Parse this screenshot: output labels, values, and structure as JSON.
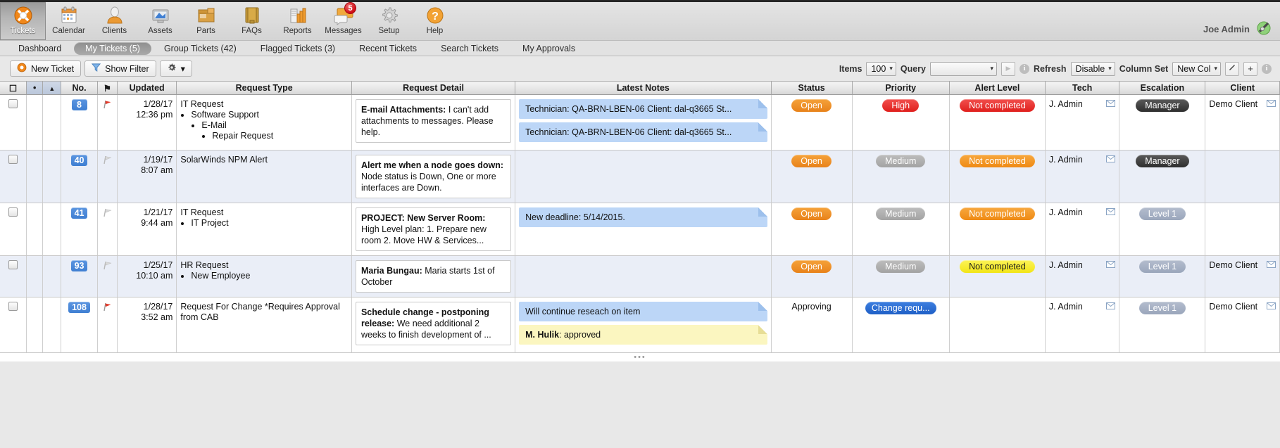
{
  "nav": {
    "items": [
      {
        "label": "Tickets",
        "icon": "lifering-icon",
        "active": true
      },
      {
        "label": "Calendar",
        "icon": "calendar-icon",
        "active": false
      },
      {
        "label": "Clients",
        "icon": "person-icon",
        "active": false
      },
      {
        "label": "Assets",
        "icon": "monitor-icon",
        "active": false
      },
      {
        "label": "Parts",
        "icon": "box-icon",
        "active": false
      },
      {
        "label": "FAQs",
        "icon": "book-icon",
        "active": false
      },
      {
        "label": "Reports",
        "icon": "bar-chart-icon",
        "active": false
      },
      {
        "label": "Messages",
        "icon": "speech-bubble-icon",
        "active": false,
        "badge": "5"
      },
      {
        "label": "Setup",
        "icon": "gear-icon",
        "active": false
      },
      {
        "label": "Help",
        "icon": "question-mark-icon",
        "active": false
      }
    ],
    "user": "Joe Admin"
  },
  "subtabs": [
    {
      "label": "Dashboard",
      "active": false
    },
    {
      "label": "My Tickets (5)",
      "active": true
    },
    {
      "label": "Group Tickets (42)",
      "active": false
    },
    {
      "label": "Flagged Tickets (3)",
      "active": false
    },
    {
      "label": "Recent Tickets",
      "active": false
    },
    {
      "label": "Search Tickets",
      "active": false
    },
    {
      "label": "My Approvals",
      "active": false
    }
  ],
  "toolbar": {
    "new_ticket_label": "New Ticket",
    "show_filter_label": "Show Filter",
    "gear_caret": "▾",
    "items_label": "Items",
    "items_value": "100",
    "query_label": "Query",
    "query_value": "",
    "run_query_glyph": "▶",
    "refresh_label": "Refresh",
    "refresh_value": "Disable",
    "column_set_label": "Column Set",
    "column_set_value": "New Col",
    "edit_glyph": "╱",
    "add_glyph": "+",
    "info_glyph": "i",
    "caret": "▾"
  },
  "table": {
    "headers": {
      "select": "☐",
      "dot": "•",
      "sort": "▲",
      "no": "No.",
      "flag": "⚑",
      "updated": "Updated",
      "request_type": "Request Type",
      "request_detail": "Request Detail",
      "latest_notes": "Latest Notes",
      "status": "Status",
      "priority": "Priority",
      "alert_level": "Alert Level",
      "tech": "Tech",
      "escalation": "Escalation",
      "client": "Client"
    },
    "rows": [
      {
        "no": "8",
        "flagged": true,
        "updated_date": "1/28/17",
        "updated_time": "12:36 pm",
        "type_main": "IT Request",
        "type_sub": "Software Support",
        "type_sub2": "E-Mail",
        "type_sub3": "Repair Request",
        "detail_title": "E-mail Attachments:",
        "detail_text": " I can't add attachments to messages. Please help.",
        "notes": [
          {
            "text": "Technician: QA-BRN-LBEN-06 Client: dal-q3665 St...",
            "color": "blue",
            "truncate": true
          },
          {
            "text": "Technician: QA-BRN-LBEN-06 Client: dal-q3665 St...",
            "color": "blue",
            "truncate": true
          }
        ],
        "status": "Open",
        "status_style": "orange",
        "priority": "High",
        "priority_style": "red",
        "alert": "Not completed",
        "alert_style": "red",
        "tech": "J. Admin",
        "escalation": "Manager",
        "escalation_style": "dark",
        "client": "Demo Client"
      },
      {
        "no": "40",
        "flagged": false,
        "updated_date": "1/19/17",
        "updated_time": "8:07 am",
        "type_main": "SolarWinds NPM Alert",
        "detail_title": "Alert me when a node goes down:",
        "detail_text": " Node status is Down, One or more interfaces are Down.",
        "notes": [],
        "status": "Open",
        "status_style": "orange",
        "priority": "Medium",
        "priority_style": "grey",
        "alert": "Not completed",
        "alert_style": "orange2",
        "tech": "J. Admin",
        "escalation": "Manager",
        "escalation_style": "dark",
        "client": ""
      },
      {
        "no": "41",
        "flagged": false,
        "updated_date": "1/21/17",
        "updated_time": "9:44 am",
        "type_main": "IT Request",
        "type_sub": "IT Project",
        "detail_title": "PROJECT: New Server Room:",
        "detail_text": " High Level plan: 1. Prepare new room 2. Move HW & Services...",
        "notes": [
          {
            "text": "New deadline: 5/14/2015.",
            "color": "blue",
            "truncate": false
          }
        ],
        "status": "Open",
        "status_style": "orange",
        "priority": "Medium",
        "priority_style": "grey",
        "alert": "Not completed",
        "alert_style": "orange2",
        "tech": "J. Admin",
        "escalation": "Level 1",
        "escalation_style": "bluegrey",
        "client": ""
      },
      {
        "no": "93",
        "flagged": false,
        "updated_date": "1/25/17",
        "updated_time": "10:10 am",
        "type_main": "HR Request",
        "type_sub": "New Employee",
        "detail_title": "Maria Bungau:",
        "detail_text": " Maria starts 1st of October",
        "notes": [],
        "status": "Open",
        "status_style": "orange",
        "priority": "Medium",
        "priority_style": "grey",
        "alert": "Not completed",
        "alert_style": "yellow",
        "tech": "J. Admin",
        "escalation": "Level 1",
        "escalation_style": "bluegrey",
        "client": "Demo Client"
      },
      {
        "no": "108",
        "flagged": true,
        "updated_date": "1/28/17",
        "updated_time": "3:52 am",
        "type_main": "Request For Change *Requires Approval from CAB",
        "detail_title": "Schedule change - postponing release:",
        "detail_text": " We need additional 2 weeks to finish development of ...",
        "notes": [
          {
            "text": "Will continue reseach on item",
            "color": "blue",
            "truncate": false
          },
          {
            "title": "M. Hulik",
            "text": ": approved",
            "color": "yellow",
            "truncate": false
          }
        ],
        "status": "Approving",
        "status_style": "plain",
        "priority": "Change requ...",
        "priority_style": "blue",
        "alert": "",
        "alert_style": "",
        "tech": "J. Admin",
        "escalation": "Level 1",
        "escalation_style": "bluegrey",
        "client": "Demo Client"
      }
    ],
    "footer_dots": "•••"
  },
  "colors": {
    "accent_orange": "#e8821a",
    "accent_blue": "#3f7fd2",
    "danger_red": "#e01f1c",
    "note_blue": "#bcd6f7",
    "note_yellow": "#fbf6c0",
    "row_alt": "#eaeef7"
  }
}
